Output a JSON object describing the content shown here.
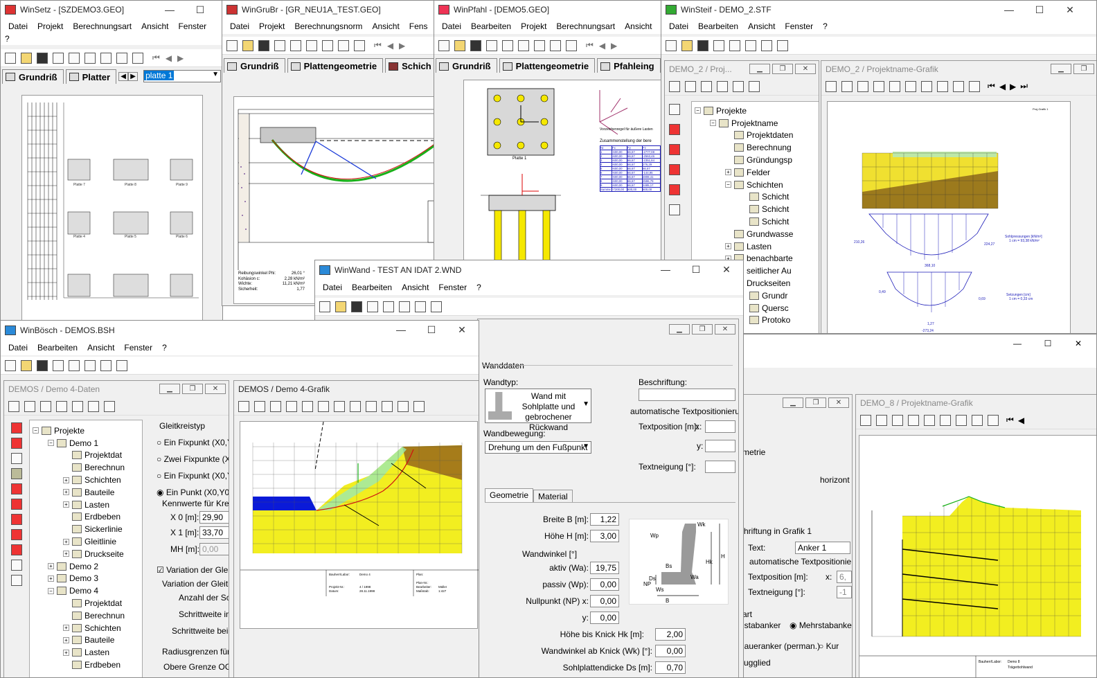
{
  "winsetz": {
    "title": "WinSetz - [SZDEMO3.GEO]",
    "menu": [
      "Datei",
      "Projekt",
      "Berechnungsart",
      "Ansicht",
      "Fenster"
    ],
    "qmark": "?",
    "tabs": [
      "Grundriß",
      "Platter"
    ],
    "combo": "platte 1",
    "plates": [
      "Platte 7",
      "Platte 8",
      "Platte 9",
      "Platte 4",
      "Platte 5",
      "Platte 6",
      "Platte 1",
      "Platte 2",
      "Platte 3"
    ]
  },
  "wingrubr": {
    "title": "WinGruBr - [GR_NEU1A_TEST.GEO]",
    "menu": [
      "Datei",
      "Projekt",
      "Berechnungsnorm",
      "Ansicht",
      "Fens"
    ],
    "tabs": [
      "Grundriß",
      "Plattengeometrie",
      "Schich"
    ],
    "props": [
      {
        "k": "Reibungswinkel Phi:",
        "v": "26,01 °"
      },
      {
        "k": "Kohäsion c:",
        "v": "2,28 kN/m²"
      },
      {
        "k": "Wichte:",
        "v": "11,21 kN/m³"
      },
      {
        "k": "Sicherheit:",
        "v": "1,77"
      }
    ]
  },
  "winpfahl": {
    "title": "WinPfahl - [DEMO5.GEO]",
    "menu": [
      "Datei",
      "Bearbeiten",
      "Projekt",
      "Berechnungsart",
      "Ansicht"
    ],
    "tabs": [
      "Grundriß",
      "Plattengeometrie",
      "Pfahleing"
    ],
    "plate_label": "Platte 1",
    "sign_caption": "Vorzeichenregel für äußere Lasten",
    "table_title": "Zusammenstellung der bere",
    "table_header": [
      "Nr.",
      "Fx",
      "Fy",
      "Fz"
    ],
    "table_rows": [
      [
        "1",
        "-600,00",
        "66,67",
        "-2777,08"
      ],
      [
        "2",
        "-600,00",
        "66,67",
        "-2563,46"
      ],
      [
        "3",
        "-600,00",
        "66,67",
        "-2351,84"
      ],
      [
        "4",
        "-600,00",
        "66,67",
        "276,29"
      ],
      [
        "5",
        "-600,00",
        "66,67",
        "66,67"
      ],
      [
        "6",
        "-600,00",
        "66,67",
        "-144,95"
      ],
      [
        "7",
        "-600,00",
        "66,67",
        "2808,41"
      ],
      [
        "8",
        "-600,00",
        "66,67",
        "2596,79"
      ],
      [
        "9",
        "-600,00",
        "66,67",
        "2485,17"
      ]
    ],
    "table_sum": [
      "Summe:",
      "-7200,00",
      "600,00",
      "600,00"
    ]
  },
  "winsteif": {
    "title": "WinSteif - DEMO_2.STF",
    "menu": [
      "Datei",
      "Bearbeiten",
      "Ansicht",
      "Fenster",
      "?"
    ],
    "tree_title": "DEMO_2 / Proj...",
    "graph_title": "DEMO_2 / Projektname-Grafik",
    "tree": [
      {
        "t": "Projekte",
        "d": 0,
        "e": "-"
      },
      {
        "t": "Projektname",
        "d": 1,
        "e": "-"
      },
      {
        "t": "Projektdaten",
        "d": 2,
        "e": ""
      },
      {
        "t": "Berechnung",
        "d": 2,
        "e": ""
      },
      {
        "t": "Gründungsp",
        "d": 2,
        "e": ""
      },
      {
        "t": "Felder",
        "d": 2,
        "e": "+"
      },
      {
        "t": "Schichten",
        "d": 2,
        "e": "-"
      },
      {
        "t": "Schicht",
        "d": 3,
        "e": ""
      },
      {
        "t": "Schicht",
        "d": 3,
        "e": ""
      },
      {
        "t": "Schicht",
        "d": 3,
        "e": ""
      },
      {
        "t": "Grundwasse",
        "d": 2,
        "e": ""
      },
      {
        "t": "Lasten",
        "d": 2,
        "e": "+"
      },
      {
        "t": "benachbarte",
        "d": 2,
        "e": "+"
      },
      {
        "t": "seitlicher Au",
        "d": 2,
        "e": "+"
      },
      {
        "t": "Druckseiten",
        "d": 2,
        "e": "-"
      },
      {
        "t": "Grundr",
        "d": 3,
        "e": ""
      },
      {
        "t": "Quersc",
        "d": 3,
        "e": ""
      },
      {
        "t": "Protoko",
        "d": 3,
        "e": ""
      }
    ],
    "graph_texts": {
      "header": "Proj-Grafik 1",
      "sohl": "Sohlpressungen [kN/m²]",
      "sohl_scale": "1 cm = 93,38 kN/m²",
      "setz": "Setzungen [cm]",
      "setz_scale": "1 cm = 0,33 cm",
      "v1": "210,26",
      "v2": "224,27",
      "v3": "368,10",
      "v4": "0,49",
      "v5": "0,69",
      "v6": "1,27",
      "v7": "-273,24"
    }
  },
  "winwand": {
    "title": "WinWand - TEST AN IDAT 2.WND",
    "menu": [
      "Datei",
      "Bearbeiten",
      "Ansicht",
      "Fenster",
      "?"
    ],
    "section": "Wanddaten",
    "wandtyp_label": "Wandtyp:",
    "wandtyp_value": "Wand mit Sohlplatte und gebrochener Rückwand",
    "bewegung_label": "Wandbewegung:",
    "bewegung_value": "Drehung um den Fußpunkt",
    "beschriftung_label": "Beschriftung:",
    "auto_text": "automatische Textpositionierung",
    "textpos_label": "Textposition [m]:",
    "x_label": "x:",
    "y_label": "y:",
    "textneig_label": "Textneigung [°]:",
    "tabs": [
      "Geometrie",
      "Material"
    ],
    "fields": [
      {
        "k": "Breite B [m]:",
        "v": "1,22"
      },
      {
        "k": "Höhe H [m]:",
        "v": "3,00"
      }
    ],
    "wandwinkel_label": "Wandwinkel [°]",
    "angles": [
      {
        "k": "aktiv (Wa):",
        "v": "19,75"
      },
      {
        "k": "passiv (Wp):",
        "v": "0,00"
      },
      {
        "k": "Nullpunkt (NP) x:",
        "v": "0,00"
      },
      {
        "k": "y:",
        "v": "0,00"
      }
    ],
    "knick": [
      {
        "k": "Höhe bis Knick Hk [m]:",
        "v": "2,00"
      },
      {
        "k": "Wandwinkel ab Knick (Wk) [°]:",
        "v": "0,00"
      },
      {
        "k": "Sohlplattendicke Ds [m]:",
        "v": "0,70"
      }
    ]
  },
  "winbosch": {
    "title": "WinBösch - DEMOS.BSH",
    "menu": [
      "Datei",
      "Bearbeiten",
      "Ansicht",
      "Fenster",
      "?"
    ],
    "data_title": "DEMOS / Demo 4-Daten",
    "graph_title": "DEMOS / Demo 4-Grafik",
    "tree": [
      {
        "t": "Projekte",
        "d": 0,
        "e": "-"
      },
      {
        "t": "Demo 1",
        "d": 1,
        "e": "-"
      },
      {
        "t": "Projektdat",
        "d": 2,
        "e": ""
      },
      {
        "t": "Berechnun",
        "d": 2,
        "e": ""
      },
      {
        "t": "Schichten",
        "d": 2,
        "e": "+"
      },
      {
        "t": "Bauteile",
        "d": 2,
        "e": "+"
      },
      {
        "t": "Lasten",
        "d": 2,
        "e": "+"
      },
      {
        "t": "Erdbeben",
        "d": 2,
        "e": ""
      },
      {
        "t": "Sickerlinie",
        "d": 2,
        "e": ""
      },
      {
        "t": "Gleitlinie",
        "d": 2,
        "e": "+"
      },
      {
        "t": "Druckseite",
        "d": 2,
        "e": "+"
      },
      {
        "t": "Demo 2",
        "d": 1,
        "e": "+"
      },
      {
        "t": "Demo 3",
        "d": 1,
        "e": "+"
      },
      {
        "t": "Demo 4",
        "d": 1,
        "e": "-"
      },
      {
        "t": "Projektdat",
        "d": 2,
        "e": ""
      },
      {
        "t": "Berechnun",
        "d": 2,
        "e": ""
      },
      {
        "t": "Schichten",
        "d": 2,
        "e": "+"
      },
      {
        "t": "Bauteile",
        "d": 2,
        "e": "+"
      },
      {
        "t": "Lasten",
        "d": 2,
        "e": "+"
      },
      {
        "t": "Erdbeben",
        "d": 2,
        "e": ""
      }
    ],
    "gleit_group": "Gleitkreistyp",
    "radios": [
      "Ein Fixpunkt (X0,Y",
      "Zwei Fixpunkte (X",
      "Ein Fixpunkt (X0,Y",
      "Ein Punkt (X0,Y0),"
    ],
    "kenn_group": "Kennwerte für Kreis",
    "x0_label": "X 0 [m]:",
    "x0": "29,90",
    "x1_label": "X 1 [m]:",
    "x1": "33,70",
    "mh_label": "MH [m]:",
    "mh": "0,00",
    "variation_check": "Variation der Gleitk",
    "variation_group": "Variation der Gleitkre",
    "anzahl": "Anzahl der Sch",
    "schrittweite": "Schrittweite in",
    "schrittweite2": "Schrittweite bei d",
    "radius_group": "Radiusgrenzen für G",
    "obere": "Obere Grenze OG:",
    "footer": {
      "bauherr": "Bauherr/Labor:",
      "bauherr_v": "Demo 4",
      "projekt": "Projekt-Nr.:",
      "projekt_v": "4 / 1998",
      "datum": "Datum:",
      "datum_v": "28.11.1998",
      "plan": "Plan:",
      "plannr": "Plan-Nr.:",
      "bearbeiter": "Bearbeiter:",
      "bearbeiter_v": "Müller",
      "massstab": "Maßstab:",
      "massstab_v": "1:427"
    }
  },
  "demo8": {
    "graph_title": "DEMO_8 / Projektname-Grafik",
    "behind": {
      "metrie": "metrie",
      "horizont": "horizont",
      "grafik1": "chriftung in Grafik 1",
      "text_label": "Text:",
      "text_value": "Anker 1",
      "auto": "automatische Textpositionieru",
      "textpos": "Textposition [m]:",
      "x": "x:",
      "xv": "6,",
      "textneig": "Textneigung [°]:",
      "tnv": "-1",
      "art": "art",
      "stabanker": "nstabanker",
      "mehr": "Mehrstabanke",
      "daueranker": "daueranker (perman.)",
      "kurz": "Kur",
      "zugglied": "zugglied"
    },
    "footer": {
      "bauherr": "Bauherr/Labor:",
      "bauherr_v": "Demo 8",
      "bauteil": "Trägerbohlwand"
    }
  }
}
